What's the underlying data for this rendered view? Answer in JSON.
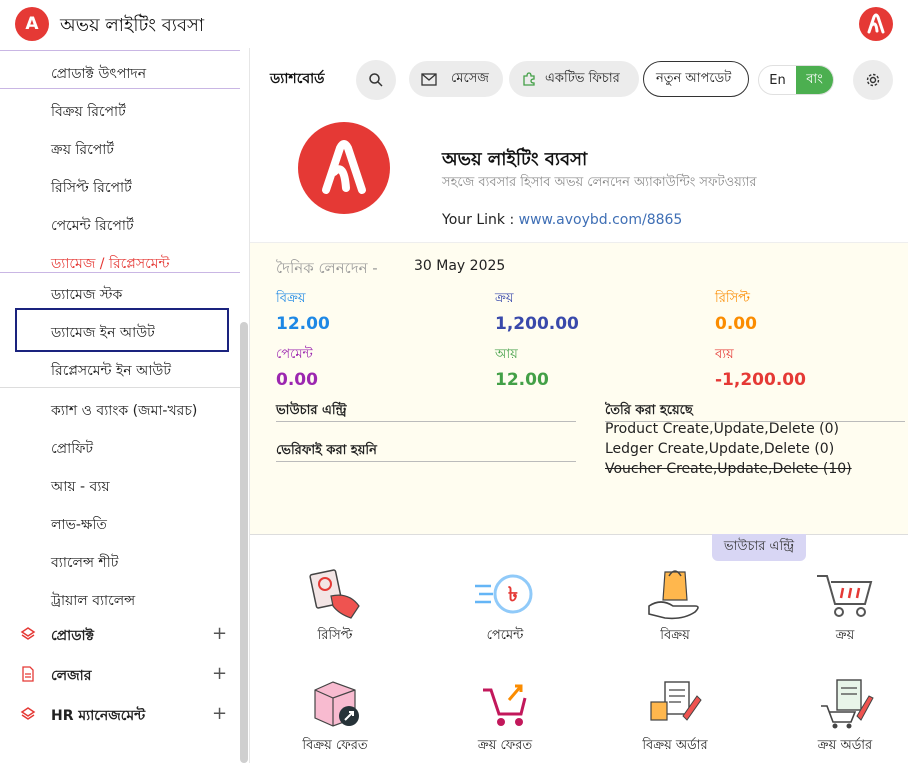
{
  "app": {
    "badge_letter": "A",
    "name": "অভয় লাইটিং ব্যবসা"
  },
  "sidebar": {
    "items_top": [
      {
        "label": "প্রোডাক্ট উৎপাদন"
      },
      {
        "label": "বিক্রয় রিপোর্ট"
      },
      {
        "label": "ক্রয় রিপোর্ট"
      },
      {
        "label": "রিসিপ্ট রিপোর্ট"
      },
      {
        "label": "পেমেন্ট রিপোর্ট"
      }
    ],
    "section_damage": "ড্যামেজ / রিপ্লেসমেন্ট",
    "items_damage": [
      {
        "label": "ড্যামেজ স্টক"
      },
      {
        "label": "ড্যামেজ ইন আউট"
      },
      {
        "label": "রিপ্লেসমেন্ট ইন আউট"
      }
    ],
    "items_accounts": [
      {
        "label": "ক্যাশ ও ব্যাংক (জমা-খরচ)"
      },
      {
        "label": "প্রোফিট"
      },
      {
        "label": "আয় - ব্যয়"
      },
      {
        "label": "লাভ-ক্ষতি"
      },
      {
        "label": "ব্যালেন্স শীট"
      },
      {
        "label": "ট্রায়াল ব্যালেন্স"
      }
    ],
    "groups": [
      {
        "label": "প্রোডাক্ট",
        "icon": "layers-icon"
      },
      {
        "label": "লেজার",
        "icon": "document-icon"
      },
      {
        "label": "HR ম্যানেজমেন্ট",
        "icon": "layers-icon"
      }
    ],
    "plus": "+"
  },
  "header": {
    "title": "ড্যাশবোর্ড",
    "message": "মেসেজ",
    "active_features": "একটিভ ফিচার",
    "new_update": "নতুন আপডেট",
    "lang_en": "En",
    "lang_bn": "বাং"
  },
  "company": {
    "name": "অভয় লাইটিং ব্যবসা",
    "tagline": "সহজে ব্যবসার হিসাব অভয় লেনদেন অ্যাকাউন্টিং সফটওয়্যার",
    "link_label": "Your Link : ",
    "link_url": "www.avoybd.com/8865"
  },
  "daily": {
    "title": "দৈনিক লেনদেন -",
    "date": "30 May 2025",
    "stats": [
      {
        "label": "বিক্রয়",
        "value": "12.00",
        "color": "#1e88e5"
      },
      {
        "label": "ক্রয়",
        "value": "1,200.00",
        "color": "#3949ab"
      },
      {
        "label": "রিসিপ্ট",
        "value": "0.00",
        "color": "#fb8c00"
      },
      {
        "label": "পেমেন্ট",
        "value": "0.00",
        "color": "#9c27b0"
      },
      {
        "label": "আয়",
        "value": "12.00",
        "color": "#43a047"
      },
      {
        "label": "ব্যয়",
        "value": "-1,200.00",
        "color": "#e53935"
      }
    ],
    "voucher_entry": "ভাউচার এন্ট্রি",
    "not_verified": "ভেরিফাই করা হয়নি",
    "created": "তৈরি করা হয়েছে",
    "logs": [
      "Product Create,Update,Delete (0)",
      "Ledger Create,Update,Delete (0)",
      "Voucher Create,Update,Delete (10)"
    ]
  },
  "voucher_section": {
    "tag": "ভাউচার এন্ট্রি",
    "tiles": [
      {
        "label": "রিসিপ্ট"
      },
      {
        "label": "পেমেন্ট"
      },
      {
        "label": "বিক্রয়"
      },
      {
        "label": "ক্রয়"
      },
      {
        "label": "বিক্রয় ফেরত"
      },
      {
        "label": "ক্রয় ফেরত"
      },
      {
        "label": "বিক্রয় অর্ডার"
      },
      {
        "label": "ক্রয় অর্ডার"
      }
    ]
  },
  "colors": {
    "brand": "#e53935",
    "accent_green": "#4caf50",
    "selection_border": "#1a237e"
  }
}
